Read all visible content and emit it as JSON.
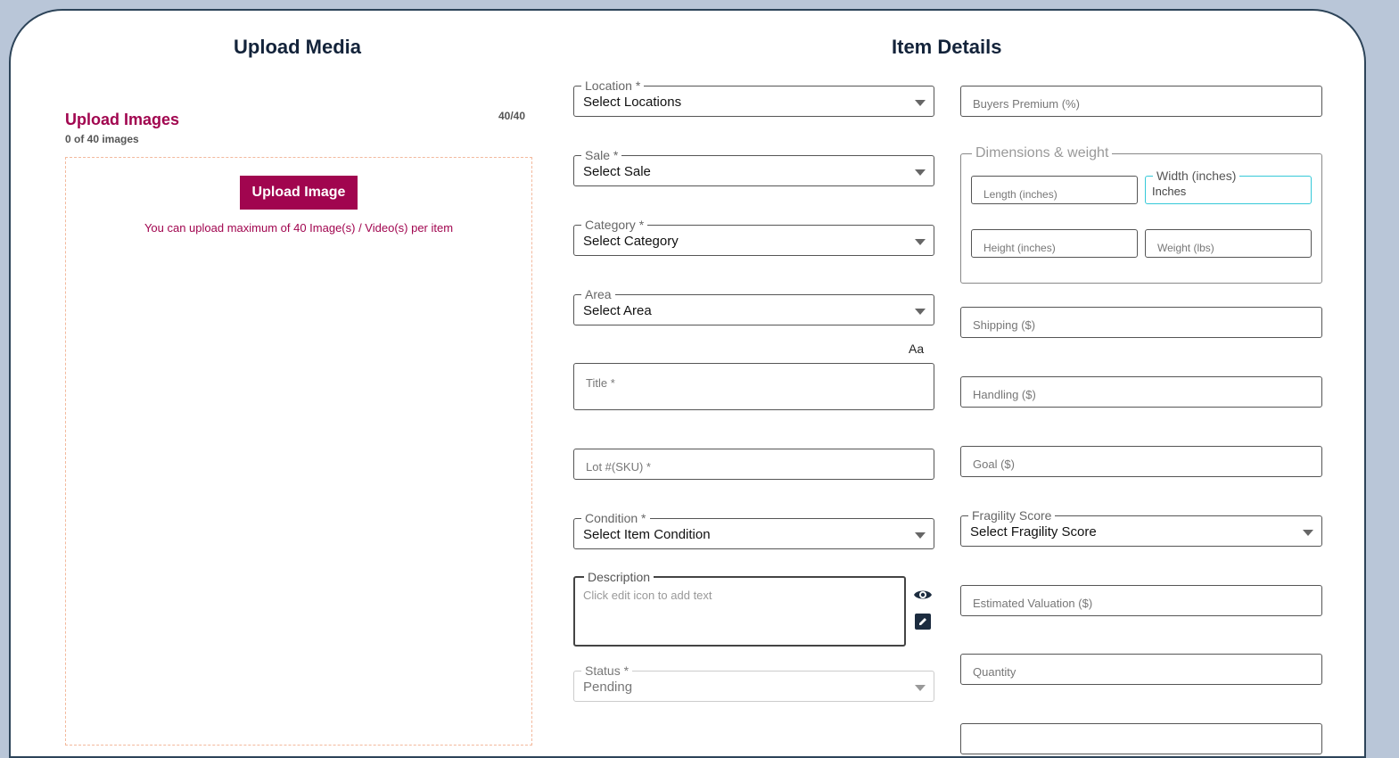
{
  "left": {
    "title": "Upload Media",
    "upload_title": "Upload Images",
    "upload_subtitle": "0 of 40 images",
    "counter": "40/40",
    "button_label": "Upload Image",
    "note": "You can upload maximum of 40 Image(s) / Video(s) per item"
  },
  "right": {
    "title": "Item Details",
    "location": {
      "label": "Location *",
      "value": "Select Locations"
    },
    "sale": {
      "label": "Sale *",
      "value": "Select Sale"
    },
    "category": {
      "label": "Category *",
      "value": "Select Category"
    },
    "area": {
      "label": "Area",
      "value": "Select Area"
    },
    "text_case_label": "Aa",
    "title_field": {
      "placeholder": "Title *"
    },
    "lot": {
      "placeholder": "Lot #(SKU) *"
    },
    "condition": {
      "label": "Condition *",
      "value": "Select Item Condition"
    },
    "description": {
      "label": "Description",
      "placeholder": "Click edit icon to add text"
    },
    "status": {
      "label": "Status *",
      "value": "Pending"
    },
    "buyers_premium": {
      "placeholder": "Buyers Premium (%)"
    },
    "dimensions": {
      "label": "Dimensions & weight",
      "length": {
        "placeholder": "Length (inches)"
      },
      "width": {
        "label": "Width (inches)",
        "value": "Inches"
      },
      "height": {
        "placeholder": "Height (inches)"
      },
      "weight": {
        "placeholder": "Weight (lbs)"
      }
    },
    "shipping": {
      "placeholder": "Shipping ($)"
    },
    "handling": {
      "placeholder": "Handling ($)"
    },
    "goal": {
      "placeholder": "Goal ($)"
    },
    "fragility": {
      "label": "Fragility Score",
      "value": "Select Fragility Score"
    },
    "valuation": {
      "placeholder": "Estimated Valuation ($)"
    },
    "quantity": {
      "placeholder": "Quantity"
    }
  },
  "colors": {
    "page_bg": "#b9c6d8",
    "accent": "#a1054f",
    "heading": "#13233a",
    "focus": "#35c9d8"
  },
  "icons": [
    "eye-icon",
    "edit-icon",
    "dropdown-caret-icon"
  ]
}
